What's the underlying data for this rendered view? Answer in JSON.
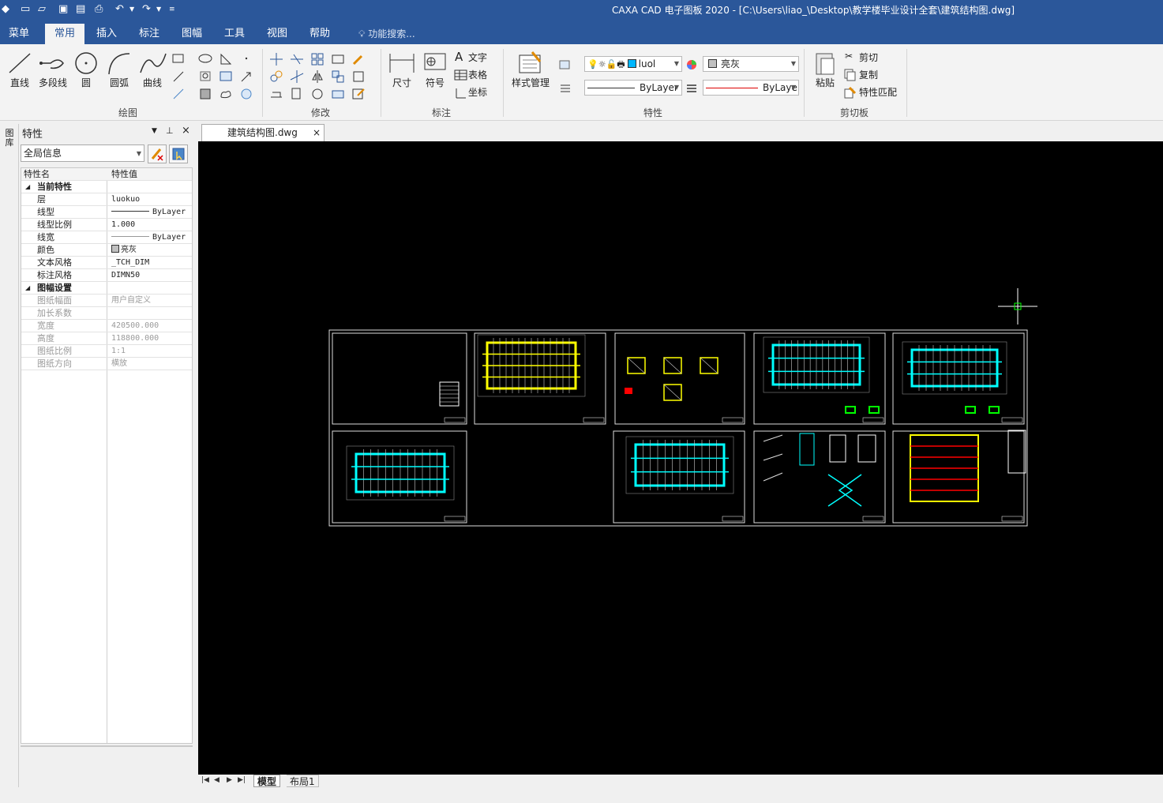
{
  "app": {
    "title": "CAXA CAD 电子图板 2020 - [C:\\Users\\liao_\\Desktop\\教学楼毕业设计全套\\建筑结构图.dwg]"
  },
  "menu": {
    "items": [
      {
        "label": "菜单",
        "active": false
      },
      {
        "label": "常用",
        "active": true
      },
      {
        "label": "插入",
        "active": false
      },
      {
        "label": "标注",
        "active": false
      },
      {
        "label": "图幅",
        "active": false
      },
      {
        "label": "工具",
        "active": false
      },
      {
        "label": "视图",
        "active": false
      },
      {
        "label": "帮助",
        "active": false
      }
    ],
    "search_placeholder": "功能搜索..."
  },
  "ribbon": {
    "draw": {
      "label": "绘图",
      "line": "直线",
      "polyline": "多段线",
      "circle": "圆",
      "arc": "圆弧",
      "curve": "曲线"
    },
    "modify": {
      "label": "修改"
    },
    "annotate": {
      "label": "标注",
      "dimension": "尺寸",
      "symbol": "符号",
      "text": "文字",
      "table": "表格",
      "coordinate": "坐标"
    },
    "properties": {
      "label": "特性",
      "style_manager": "样式管理",
      "layer_value": "luol",
      "color_value": "亮灰",
      "linetype_value": "ByLayer",
      "lineweight_value": "ByLaye"
    },
    "clipboard": {
      "label": "剪切板",
      "paste": "粘贴",
      "cut": "剪切",
      "copy": "复制",
      "match": "特性匹配"
    }
  },
  "side_strip": {
    "label": "图库"
  },
  "properties_panel": {
    "title": "特性",
    "filter_value": "全局信息",
    "col_name": "特性名",
    "col_value": "特性值",
    "rows": [
      {
        "name": "当前特性",
        "value": "",
        "section": true
      },
      {
        "name": "层",
        "value": "luokuo"
      },
      {
        "name": "线型",
        "value": "ByLayer"
      },
      {
        "name": "线型比例",
        "value": "1.000"
      },
      {
        "name": "线宽",
        "value": "ByLayer"
      },
      {
        "name": "颜色",
        "value": "亮灰"
      },
      {
        "name": "文本风格",
        "value": "_TCH_DIM"
      },
      {
        "name": "标注风格",
        "value": "DIMN50"
      },
      {
        "name": "图幅设置",
        "value": "",
        "section": true
      },
      {
        "name": "图纸幅面",
        "value": "用户自定义",
        "disabled": true
      },
      {
        "name": "加长系数",
        "value": "",
        "disabled": true
      },
      {
        "name": "宽度",
        "value": "420500.000",
        "disabled": true
      },
      {
        "name": "高度",
        "value": "118800.000",
        "disabled": true
      },
      {
        "name": "图纸比例",
        "value": "1:1",
        "disabled": true
      },
      {
        "name": "图纸方向",
        "value": "横放",
        "disabled": true
      }
    ]
  },
  "document": {
    "tab_label": "建筑结构图.dwg"
  },
  "layouts": {
    "tabs": [
      {
        "label": "模型",
        "active": true
      },
      {
        "label": "布局1",
        "active": false
      }
    ]
  },
  "colors": {
    "accent": "#2b579a",
    "canvas": "#000000",
    "cyan": "#00ffff",
    "yellow": "#ffff00",
    "green": "#00ff00",
    "red": "#ff0000"
  }
}
